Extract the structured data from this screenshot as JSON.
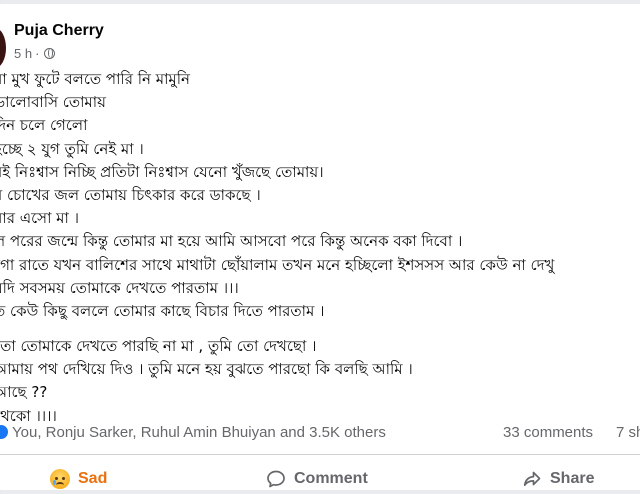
{
  "post": {
    "author": "Puja Cherry",
    "time": "5 h",
    "separator": "·",
    "lines": [
      "মা মুখ ফুটে বলতে পারি নি মামুনি",
      "ভালোবাসি তোমায়",
      "দিন চলে গেলো",
      "হচ্ছে ২ যুগ তুমি নেই মা ।",
      "রই নিঃশ্বাস নিচ্ছি প্রতিটা নিঃশ্বাস যেনো খুঁজছে তোমায়।",
      "র চোখের জল তোমায় চিৎকার করে ডাকছে ।",
      "বার এসো মা ।",
      "ল পরের জন্মে কিন্তু তোমার মা হয়ে আমি আসবো পরে কিন্তু অনেক বকা দিবো ।",
      "গো রাতে যখন বালিশের সাথে মাথাটা ছোঁয়ালাম তখন মনে হচ্ছিলো ইশসসস আর কেউ না দেখু",
      "যদি সবসময় তোমাকে দেখতে পারতাম ।।।",
      "ত কেউ কিছু বললে তোমার কাছে বিচার দিতে পারতাম ।",
      "তো তোমাকে দেখতে পারছি না মা , তুমি তো দেখছো ।",
      "আমায় পথ দেখিয়ে দিও । তুমি মনে হয় বুঝতে পারছো কি বলছি আমি ।",
      "আছে ??",
      "থেকো ।।।।"
    ]
  },
  "stats": {
    "reactions": "You, Ronju Sarker, Ruhul Amin Bhuiyan and 3.5K others",
    "comments": "33 comments",
    "shares": "7 sh"
  },
  "actions": {
    "sad": "Sad",
    "comment": "Comment",
    "share": "Share"
  },
  "colors": {
    "sad_accent": "#e9710f",
    "muted": "#65676b",
    "reaction_blue": "#1877f2"
  }
}
